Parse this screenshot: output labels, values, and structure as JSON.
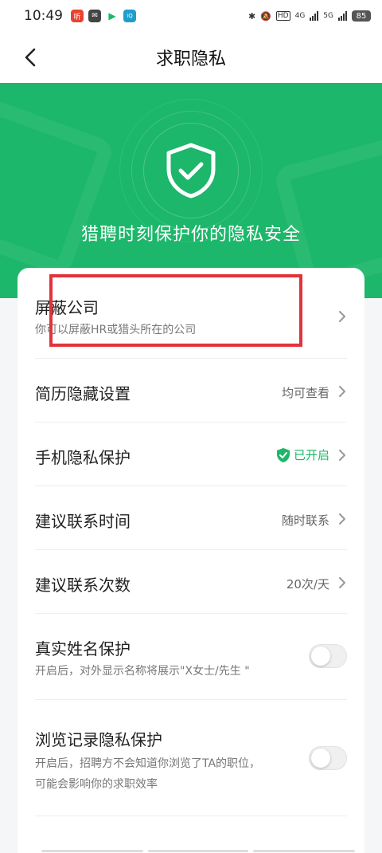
{
  "status_bar": {
    "time": "10:49",
    "network_4g": "4G",
    "network_5g": "5G",
    "hd": "HD",
    "battery": "85"
  },
  "nav": {
    "title": "求职隐私"
  },
  "hero": {
    "title": "猎聘时刻保护你的隐私安全",
    "bg_color": "#1cb76a"
  },
  "settings": {
    "block_company": {
      "title": "屏蔽公司",
      "subtitle": "你可以屏蔽HR或猎头所在的公司"
    },
    "resume_hide": {
      "title": "简历隐藏设置",
      "value": "均可查看"
    },
    "phone_privacy": {
      "title": "手机隐私保护",
      "value": "已开启"
    },
    "contact_time": {
      "title": "建议联系时间",
      "value": "随时联系"
    },
    "contact_count": {
      "title": "建议联系次数",
      "value": "20次/天"
    },
    "real_name": {
      "title": "真实姓名保护",
      "subtitle": "开启后，对外显示名称将展示\"X女士/先生 \"",
      "enabled": false
    },
    "browse_history": {
      "title": "浏览记录隐私保护",
      "subtitle_line1": "开启后，招聘方不会知道你浏览了TA的职位，",
      "subtitle_line2": "可能会影响你的求职效率",
      "enabled": false
    }
  },
  "colors": {
    "accent": "#1cb76a",
    "annotation": "#e2333a"
  }
}
